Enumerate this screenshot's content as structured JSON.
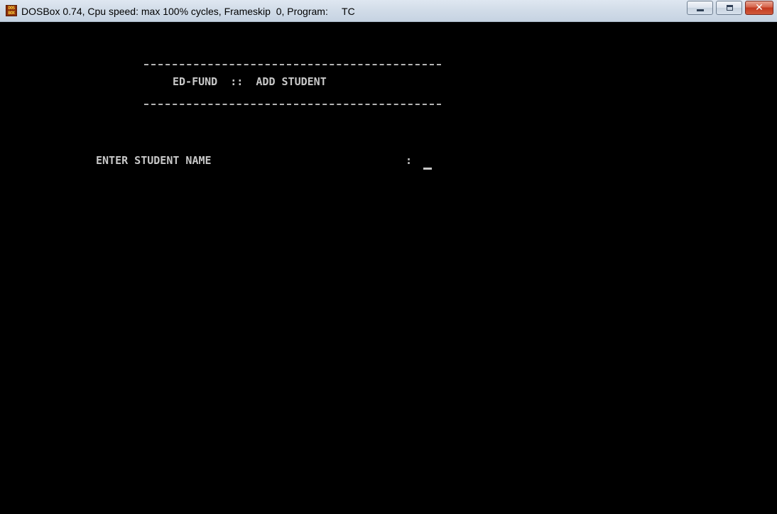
{
  "window": {
    "title": "DOSBox 0.74, Cpu speed: max 100% cycles, Frameskip  0, Program:     TC",
    "icon": "dosbox-icon",
    "icon_text": "DOS BOX",
    "buttons": [
      "minimize-icon",
      "maximize-icon",
      "close-icon"
    ],
    "close_glyph": "✕"
  },
  "screen": {
    "header_title": "ED-FUND  ::  ADD STUDENT",
    "prompt_label": "ENTER STUDENT NAME",
    "prompt_separator": ":",
    "input_value": "",
    "colors": {
      "background": "#000000",
      "text": "#c8c8c8"
    }
  }
}
